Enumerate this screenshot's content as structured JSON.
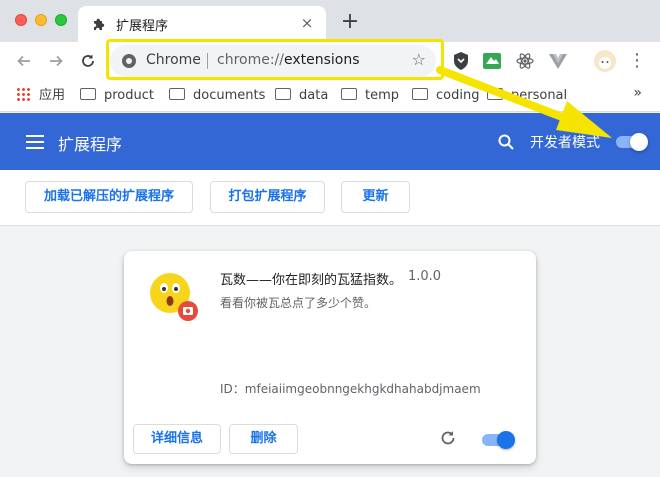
{
  "colors": {
    "brand_blue": "#3367d6",
    "link_blue": "#1a73e8",
    "highlight_yellow": "#f5e400"
  },
  "tab": {
    "title": "扩展程序",
    "icon": "puzzle-icon",
    "close": "×"
  },
  "new_tab": "+",
  "omnibox": {
    "chip": "Chrome",
    "url_prefix": "chrome://",
    "url_path": "extensions"
  },
  "toolbar_icons": [
    "shield-extension-icon",
    "tag-extension-icon",
    "react-extension-icon",
    "vue-extension-icon",
    "profile-avatar-icon"
  ],
  "bookmarks": {
    "items": [
      {
        "label": "应用",
        "icon": "apps-grid-icon"
      },
      {
        "label": "product",
        "icon": "folder-icon"
      },
      {
        "label": "documents",
        "icon": "folder-icon"
      },
      {
        "label": "data",
        "icon": "folder-icon"
      },
      {
        "label": "temp",
        "icon": "folder-icon"
      },
      {
        "label": "coding",
        "icon": "folder-icon"
      },
      {
        "label": "personal",
        "icon": "folder-icon"
      }
    ],
    "more": "»"
  },
  "header": {
    "title": "扩展程序",
    "dev_mode_label": "开发者模式",
    "dev_mode_on": true
  },
  "actions": {
    "load_unpacked": "加载已解压的扩展程序",
    "pack": "打包扩展程序",
    "update": "更新"
  },
  "extension": {
    "name": "瓦数——你在即刻的瓦猛指数。",
    "version": "1.0.0",
    "description": "看看你被瓦总点了多少个赞。",
    "id_label": "ID：",
    "id": "mfeiaiimgeobnngekhgkdhahabdjmaem",
    "details_button": "详细信息",
    "remove_button": "删除",
    "enabled": true
  }
}
